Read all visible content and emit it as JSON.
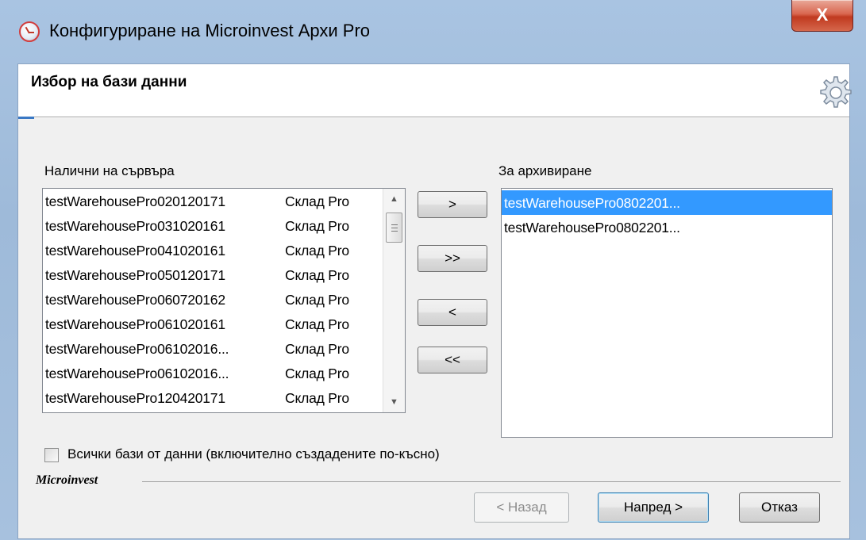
{
  "window": {
    "title": "Конфигуриране на Microinvest Архи Pro",
    "close_label": "X"
  },
  "header": {
    "title": "Избор на бази данни"
  },
  "available": {
    "label": "Налични на сървъра",
    "rows": [
      {
        "name": "testWarehousePro020120171",
        "type": "Склад Pro"
      },
      {
        "name": "testWarehousePro031020161",
        "type": "Склад Pro"
      },
      {
        "name": "testWarehousePro041020161",
        "type": "Склад Pro"
      },
      {
        "name": "testWarehousePro050120171",
        "type": "Склад Pro"
      },
      {
        "name": "testWarehousePro060720162",
        "type": "Склад Pro"
      },
      {
        "name": "testWarehousePro061020161",
        "type": "Склад Pro"
      },
      {
        "name": "testWarehousePro06102016...",
        "type": "Склад Pro"
      },
      {
        "name": "testWarehousePro06102016...",
        "type": "Склад Pro"
      },
      {
        "name": "testWarehousePro120420171",
        "type": "Склад Pro"
      }
    ]
  },
  "selected": {
    "label": "За архивиране",
    "rows": [
      {
        "name": "testWarehousePro0802201...",
        "highlighted": true
      },
      {
        "name": "testWarehousePro0802201...",
        "highlighted": false
      }
    ]
  },
  "transfer_buttons": {
    "add_one": ">",
    "add_all": ">>",
    "remove_one": "<",
    "remove_all": "<<"
  },
  "all_databases": {
    "label": "Всички бази от данни (включително създадените по-късно)",
    "checked": false
  },
  "footer": {
    "brand": "Microinvest",
    "back_label": "< Назад",
    "next_label": "Напред >",
    "cancel_label": "Отказ"
  },
  "colors": {
    "selection": "#3399ff",
    "frame": "#a9c4e2",
    "close_button": "#c0391f"
  }
}
